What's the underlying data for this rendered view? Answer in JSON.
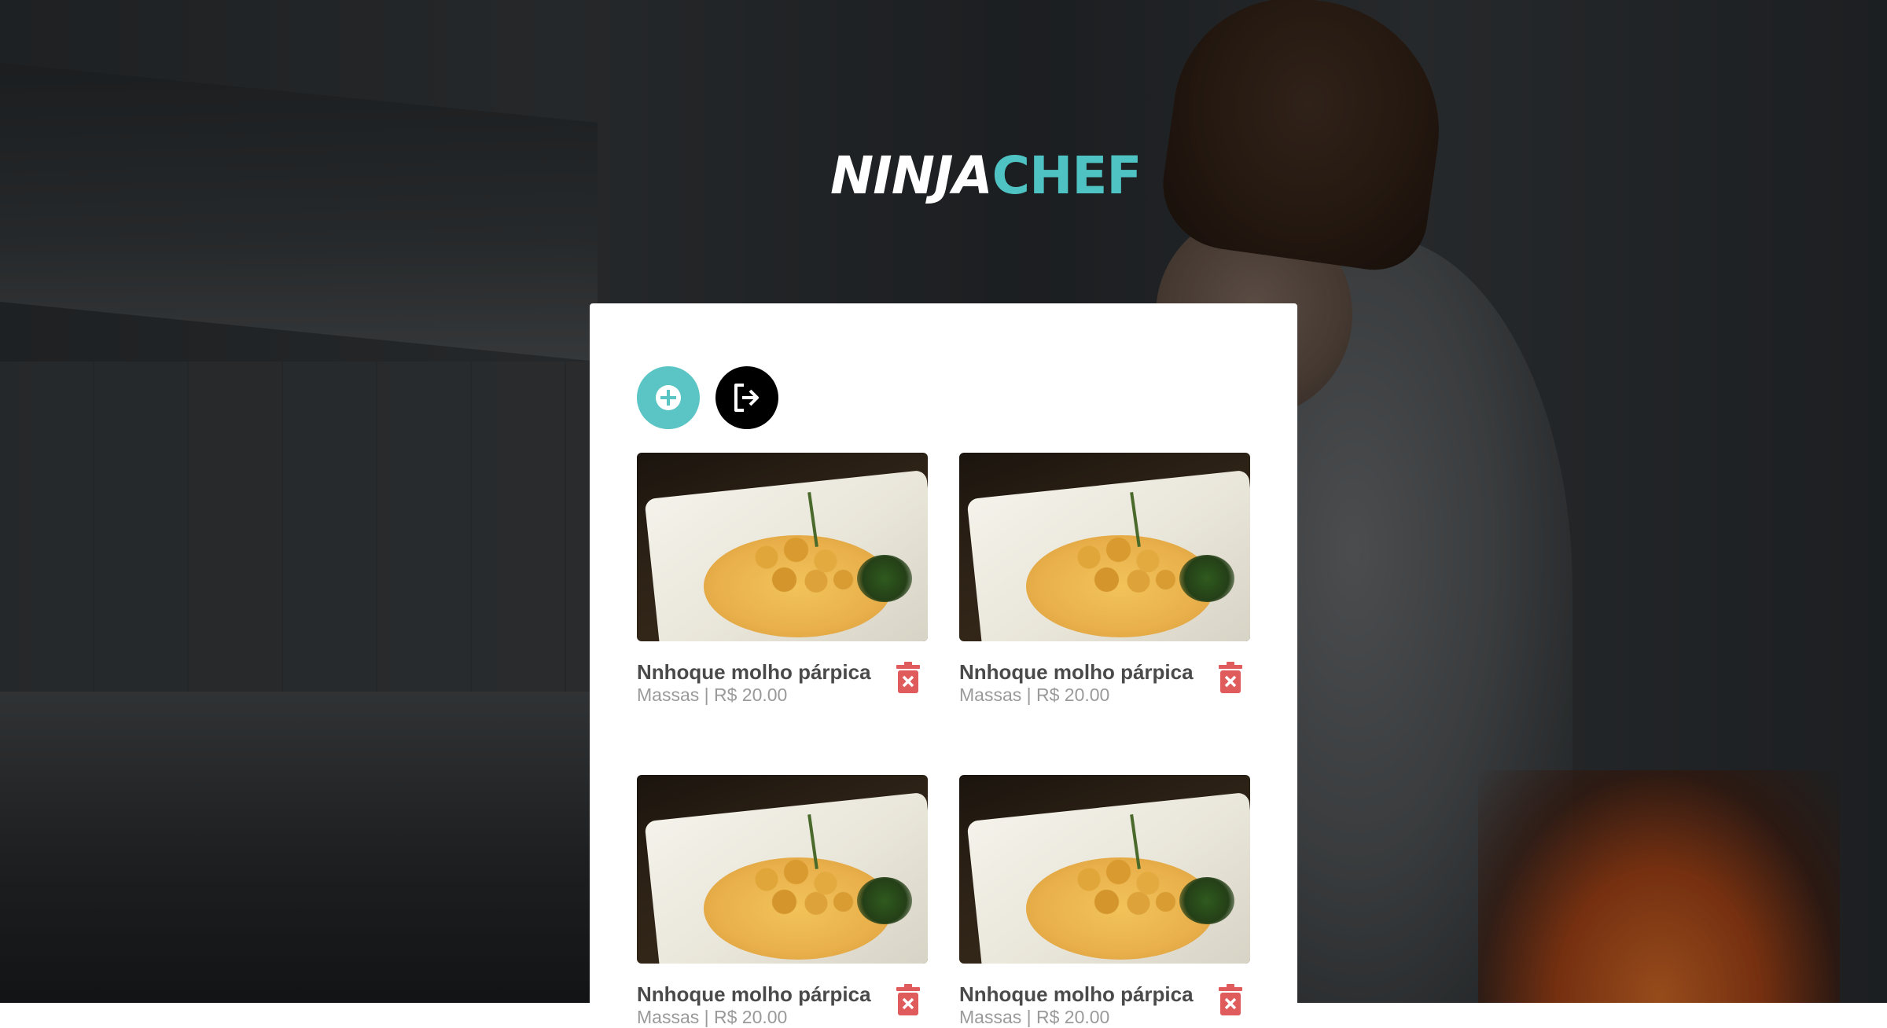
{
  "brand": {
    "ninja": "NINJA",
    "chef": "CHEF",
    "accent_color": "#5bc4c4"
  },
  "toolbar": {
    "add_icon": "plus-circle-icon",
    "logout_icon": "sign-out-icon"
  },
  "dishes": [
    {
      "name": "Nnhoque molho párpica",
      "meta": "Massas | R$ 20.00"
    },
    {
      "name": "Nnhoque molho párpica",
      "meta": "Massas | R$ 20.00"
    },
    {
      "name": "Nnhoque molho párpica",
      "meta": "Massas | R$ 20.00"
    },
    {
      "name": "Nnhoque molho párpica",
      "meta": "Massas | R$ 20.00"
    }
  ],
  "delete_color": "#e05b5b"
}
